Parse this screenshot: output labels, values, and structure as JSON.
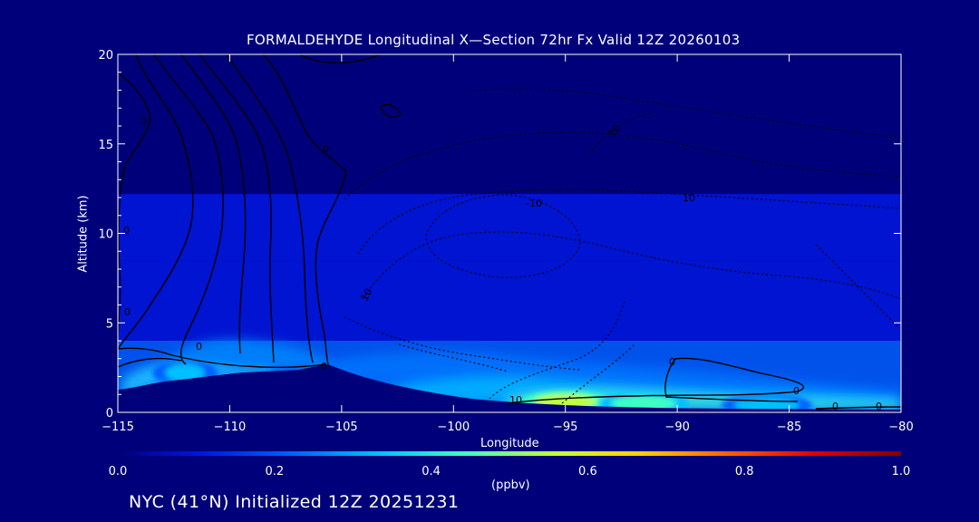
{
  "chart_data": {
    "type": "heatmap",
    "title": "FORMALDEHYDE Longitudinal X—Section 72hr  Fx Valid 12Z 20260103",
    "xlabel": "Longitude",
    "ylabel": "Altitude (km)",
    "xlim": [
      -115,
      -80
    ],
    "ylim": [
      0,
      20
    ],
    "x_ticks": [
      "−115",
      "−110",
      "−105",
      "−100",
      "−95",
      "−90",
      "−85",
      "−80"
    ],
    "x_tick_values": [
      -115,
      -110,
      -105,
      -100,
      -95,
      -90,
      -85,
      -80
    ],
    "y_ticks": [
      "0",
      "5",
      "10",
      "15",
      "20"
    ],
    "y_tick_values": [
      0,
      5,
      10,
      15,
      20
    ],
    "colorbar": {
      "label": "(ppbv)",
      "range": [
        0.0,
        1.0
      ],
      "ticks": [
        "0.0",
        "0.2",
        "0.4",
        "0.6",
        "0.8",
        "1.0"
      ],
      "tick_values": [
        0.0,
        0.2,
        0.4,
        0.6,
        0.8,
        1.0
      ],
      "colormap": [
        "#00007a",
        "#0018e0",
        "#0060ff",
        "#00c0ff",
        "#40ffc0",
        "#c0ff40",
        "#ffd000",
        "#ff6000",
        "#e00000",
        "#800000"
      ]
    },
    "contour_labels": [
      "0",
      "10",
      "-10"
    ],
    "background_bands": [
      {
        "alt_from": 0,
        "alt_to": 4,
        "value": 0.25
      },
      {
        "alt_from": 4,
        "alt_to": 8.5,
        "value": 0.15
      },
      {
        "alt_from": 8.5,
        "alt_to": 12.2,
        "value": 0.09
      },
      {
        "alt_from": 12.2,
        "alt_to": 20,
        "value": 0.02
      }
    ],
    "hotspots": [
      {
        "lon": -95,
        "alt": 0.6,
        "value": 0.58
      },
      {
        "lon": -91.5,
        "alt": 0.5,
        "value": 0.45
      },
      {
        "lon": -86,
        "alt": 0.4,
        "value": 0.38
      },
      {
        "lon": -112,
        "alt": 2.2,
        "value": 0.35
      }
    ]
  },
  "footer": {
    "initialized": "NYC (41°N) Initialized 12Z 20251231"
  }
}
